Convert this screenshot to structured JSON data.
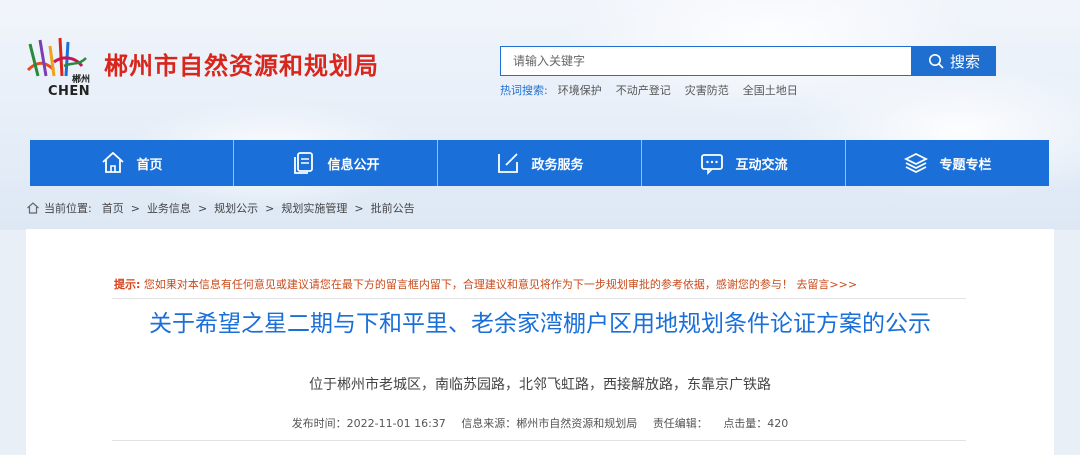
{
  "header": {
    "site_title": "郴州市自然资源和规划局",
    "logo_text": "CHEN",
    "logo_city": "郴州"
  },
  "search": {
    "placeholder": "请输入关键字",
    "button_label": "搜索",
    "hot_label": "热词搜索:",
    "hot_words": [
      "环境保护",
      "不动产登记",
      "灾害防范",
      "全国土地日"
    ]
  },
  "nav": {
    "items": [
      {
        "label": "首页",
        "icon": "home-icon"
      },
      {
        "label": "信息公开",
        "icon": "document-icon"
      },
      {
        "label": "政务服务",
        "icon": "edit-icon"
      },
      {
        "label": "互动交流",
        "icon": "chat-icon"
      },
      {
        "label": "专题专栏",
        "icon": "layers-icon"
      }
    ]
  },
  "breadcrumb": {
    "label": "当前位置:",
    "items": [
      "首页",
      "业务信息",
      "规划公示",
      "规划实施管理",
      "批前公告"
    ]
  },
  "tip": {
    "label": "提示:",
    "text": "您如果对本信息有任何意见或建议请您在最下方的留言框内留下，合理建议和意见将作为下一步规划审批的参考依据，感谢您的参与！",
    "link": "去留言>>>"
  },
  "article": {
    "title": "关于希望之星二期与下和平里、老余家湾棚户区用地规划条件论证方案的公示",
    "subtitle": "位于郴州市老城区，南临苏园路，北邻飞虹路，西接解放路，东靠京广铁路",
    "publish_time": "发布时间：2022-11-01 16:37",
    "source": "信息来源：郴州市自然资源和规划局",
    "editor": "责任编辑：",
    "views": "点击量：420"
  },
  "colors": {
    "brand_red": "#d9261c",
    "nav_blue": "#1a6fd8",
    "title_blue": "#1a6fd8",
    "tip_orange": "#c94a1a"
  }
}
